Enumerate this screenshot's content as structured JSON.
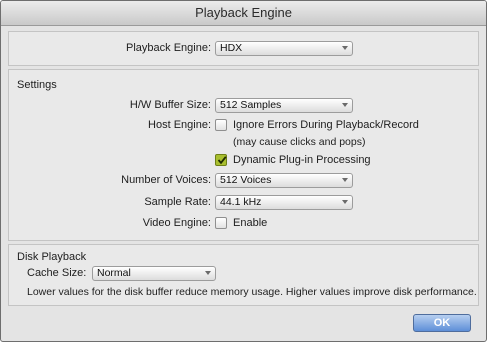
{
  "window": {
    "title": "Playback Engine"
  },
  "playback_engine": {
    "label": "Playback Engine:",
    "value": "HDX"
  },
  "settings": {
    "title": "Settings",
    "hw_buffer": {
      "label": "H/W Buffer Size:",
      "value": "512 Samples"
    },
    "host_engine": {
      "label": "Host Engine:",
      "ignore_errors_label": "Ignore Errors During Playback/Record",
      "ignore_errors_checked": false,
      "ignore_errors_note": "(may cause clicks and pops)",
      "dynamic_plugin_label": "Dynamic Plug-in Processing",
      "dynamic_plugin_checked": true
    },
    "voices": {
      "label": "Number of Voices:",
      "value": "512 Voices"
    },
    "sample_rate": {
      "label": "Sample Rate:",
      "value": "44.1 kHz"
    },
    "video_engine": {
      "label": "Video Engine:",
      "enable_label": "Enable",
      "checked": false
    }
  },
  "disk_playback": {
    "title": "Disk Playback",
    "cache_size": {
      "label": "Cache Size:",
      "value": "Normal"
    },
    "description": "Lower values for the disk buffer reduce memory usage.  Higher values improve disk performance."
  },
  "ok_button": {
    "label": "OK"
  },
  "colors": {
    "accent_check": "#a9bf2f",
    "ok_button": "#5e8fd8"
  }
}
